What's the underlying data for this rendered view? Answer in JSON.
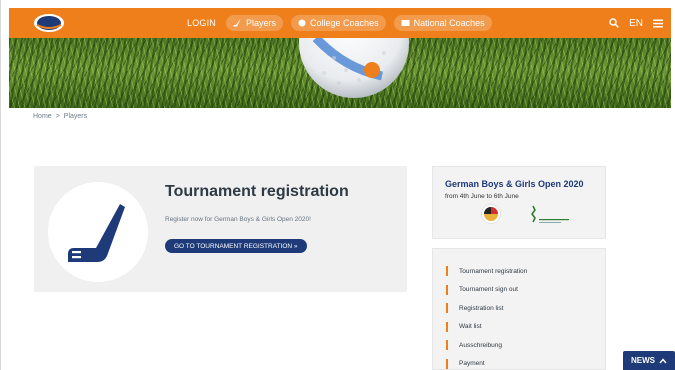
{
  "nav": {
    "login": "LOGIN",
    "players": "Players",
    "college_coaches": "College Coaches",
    "national_coaches": "National Coaches",
    "language": "EN",
    "search_icon": "search-icon",
    "menu_icon": "menu-icon"
  },
  "breadcrumb": {
    "home": "Home",
    "separator": ">",
    "current": "Players"
  },
  "card": {
    "icon": "golf-club-icon",
    "title": "Tournament registration",
    "subtitle": "Register now for German Boys & Girls Open 2020!",
    "button": "GO TO TOURNAMENT REGISTRATION »"
  },
  "event": {
    "title": "German Boys & Girls Open 2020",
    "dates": "from 4th June to 6th June"
  },
  "sidebar": {
    "items": [
      {
        "label": "Tournament registration"
      },
      {
        "label": "Tournament sign out"
      },
      {
        "label": "Registration list"
      },
      {
        "label": "Wait list"
      },
      {
        "label": "Ausschreibung"
      },
      {
        "label": "Payment"
      }
    ]
  },
  "news": {
    "label": "NEWS",
    "icon": "chevron-up-icon"
  },
  "colors": {
    "nav_orange": "#ef7f1a",
    "brand_navy": "#1e3a78",
    "card_bg": "#f0f0f0"
  }
}
